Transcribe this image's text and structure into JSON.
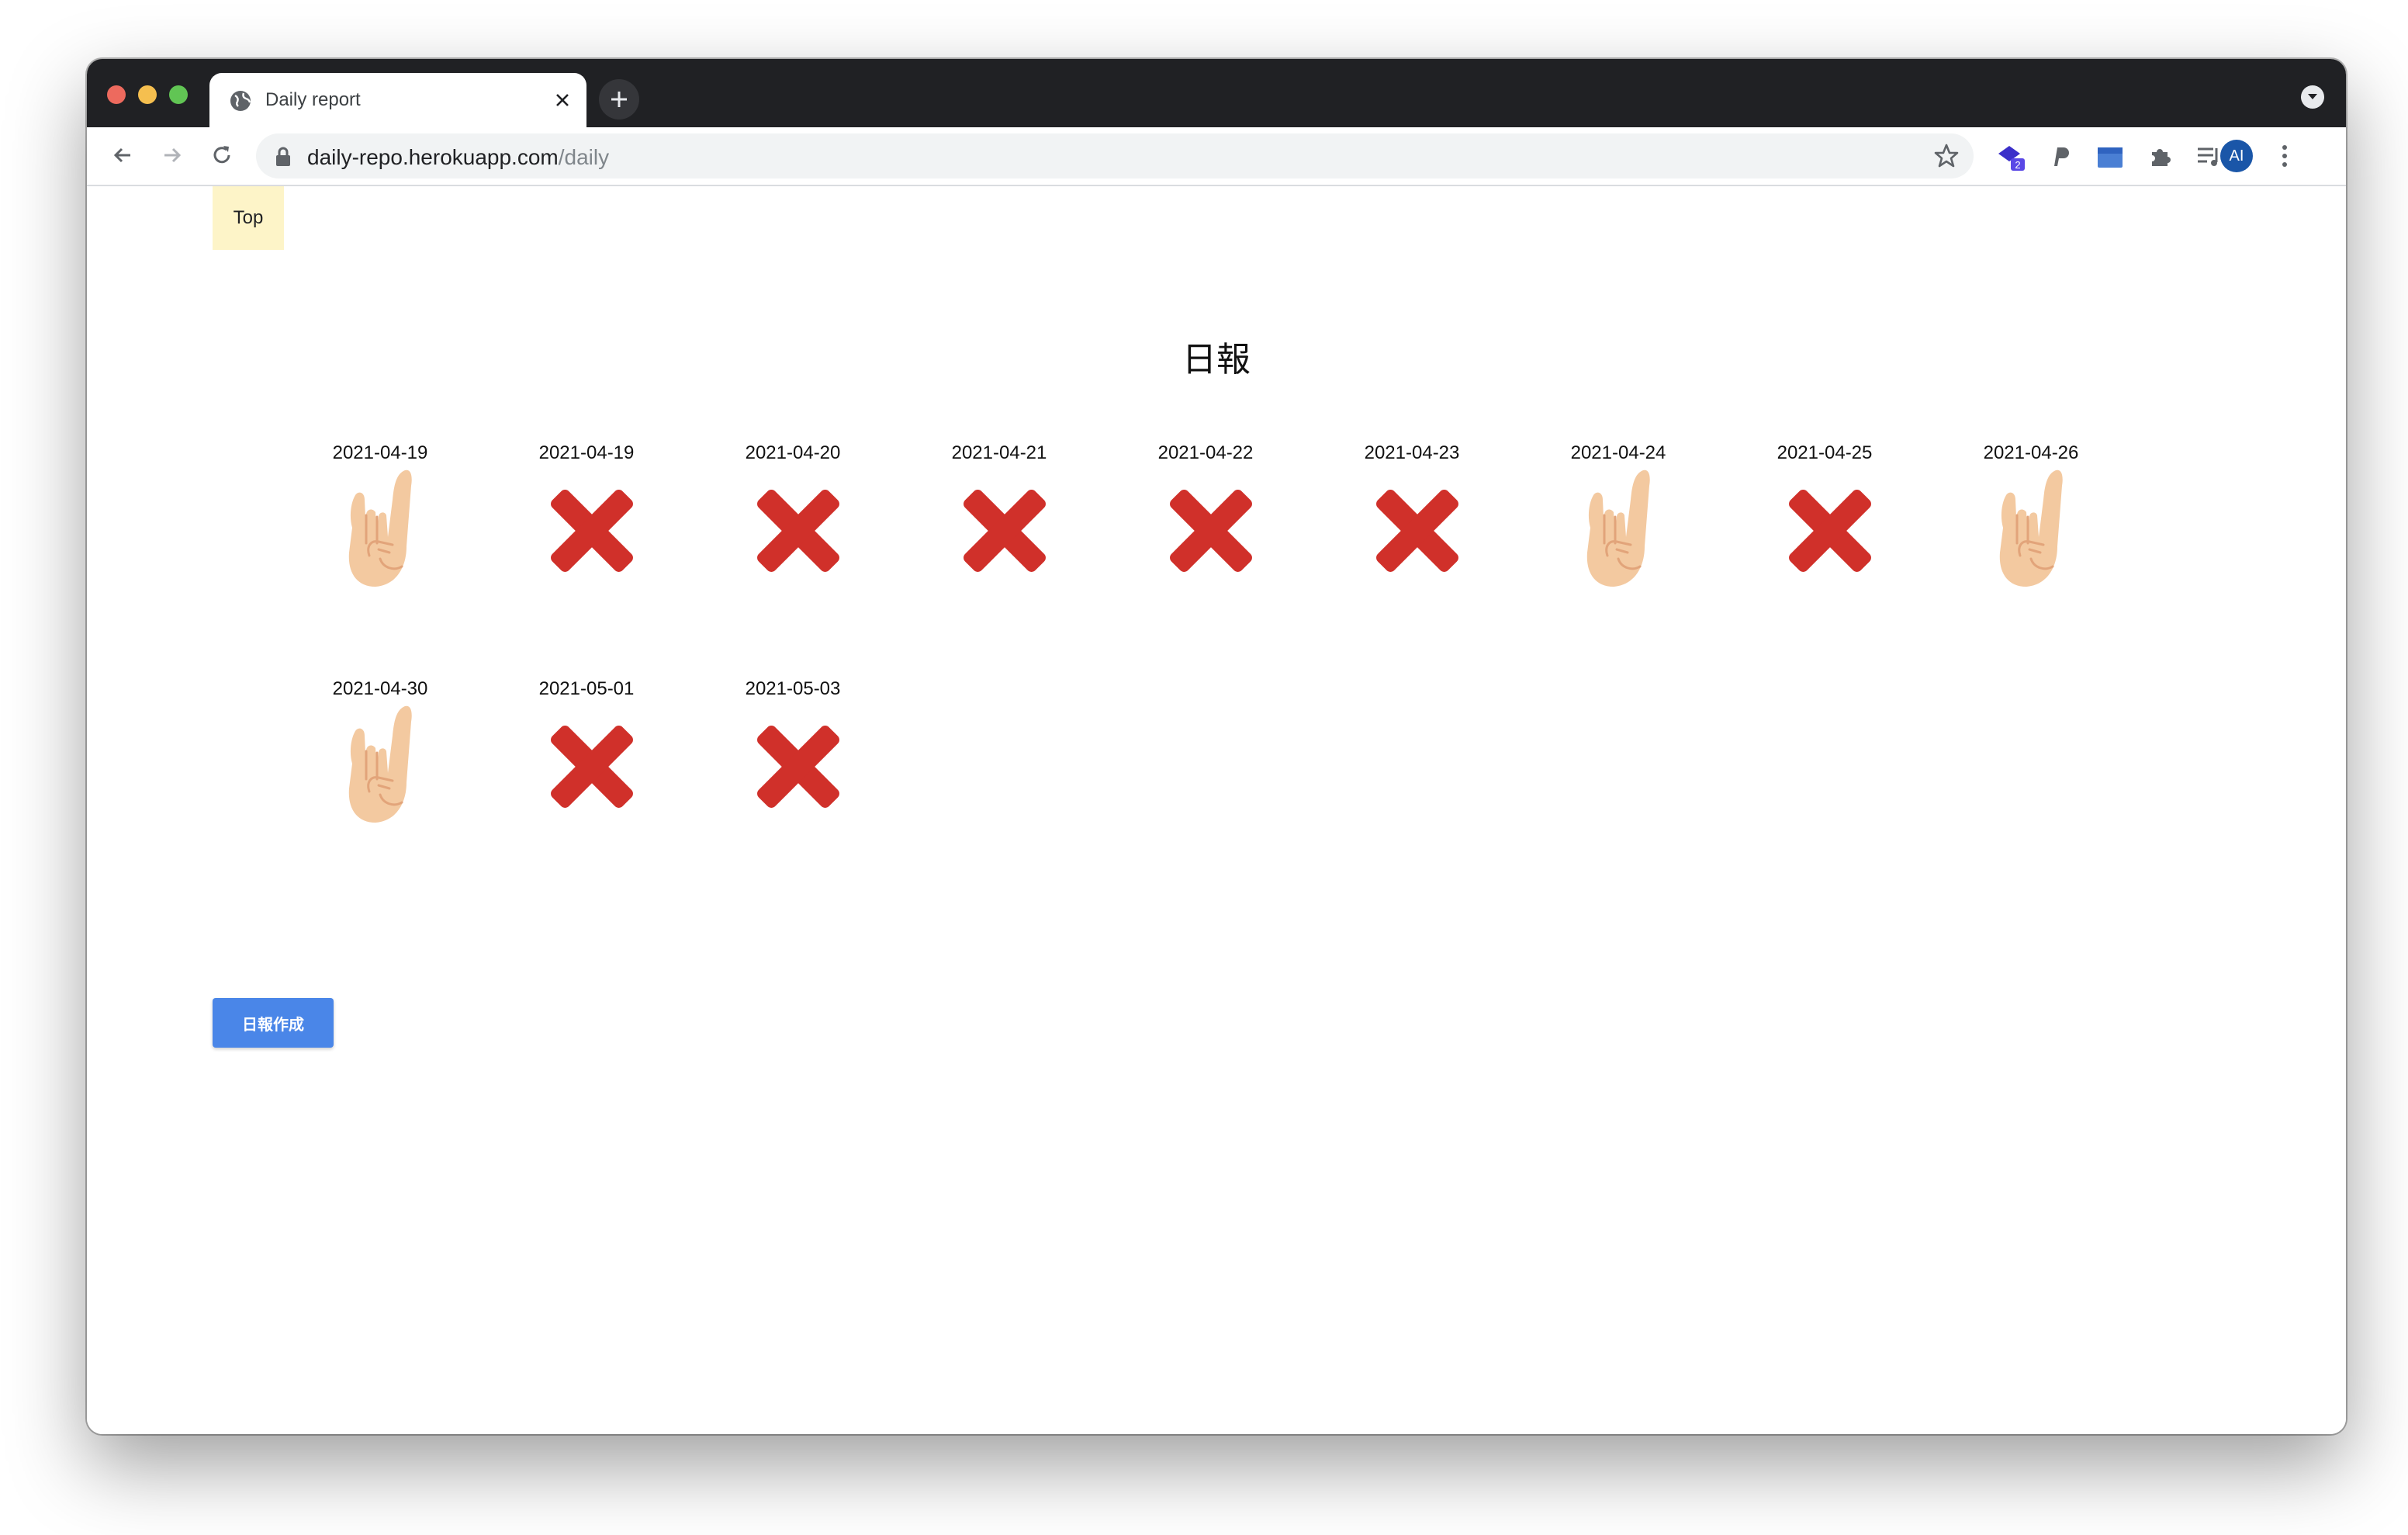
{
  "browser": {
    "tab_title": "Daily report",
    "url_host": "daily-repo.herokuapp.com",
    "url_path": "/daily",
    "avatar_initials": "AI",
    "extension_badge": "2",
    "icons": [
      "globe-icon",
      "close-icon",
      "plus-icon",
      "back-icon",
      "forward-icon",
      "reload-icon",
      "lock-icon",
      "star-icon",
      "extension-icon",
      "puzzle-icon",
      "media-icon",
      "more-icon"
    ]
  },
  "page": {
    "top_link": "Top",
    "title": "日報",
    "create_button": "日報作成",
    "colors": {
      "create_button": "#4a86e8",
      "top_link_bg": "#fdf4c8",
      "cross": "#d0302a",
      "hand": "#f3c9a0"
    },
    "reports": [
      {
        "date": "2021-04-19",
        "status": "done",
        "icon": "rock-on-hand-icon"
      },
      {
        "date": "2021-04-19",
        "status": "missing",
        "icon": "cross-mark-icon"
      },
      {
        "date": "2021-04-20",
        "status": "missing",
        "icon": "cross-mark-icon"
      },
      {
        "date": "2021-04-21",
        "status": "missing",
        "icon": "cross-mark-icon"
      },
      {
        "date": "2021-04-22",
        "status": "missing",
        "icon": "cross-mark-icon"
      },
      {
        "date": "2021-04-23",
        "status": "missing",
        "icon": "cross-mark-icon"
      },
      {
        "date": "2021-04-24",
        "status": "done",
        "icon": "rock-on-hand-icon"
      },
      {
        "date": "2021-04-25",
        "status": "missing",
        "icon": "cross-mark-icon"
      },
      {
        "date": "2021-04-26",
        "status": "done",
        "icon": "rock-on-hand-icon"
      },
      {
        "date": "2021-04-30",
        "status": "done",
        "icon": "rock-on-hand-icon"
      },
      {
        "date": "2021-05-01",
        "status": "missing",
        "icon": "cross-mark-icon"
      },
      {
        "date": "2021-05-03",
        "status": "missing",
        "icon": "cross-mark-icon"
      }
    ]
  }
}
